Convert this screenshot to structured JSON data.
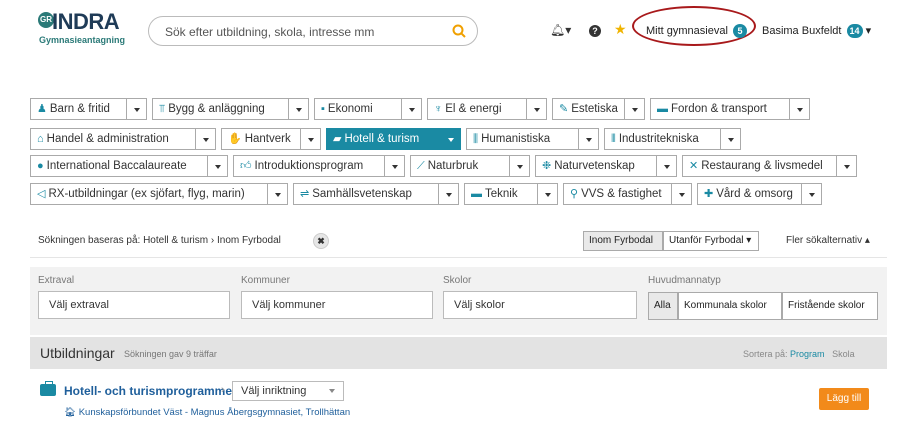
{
  "header": {
    "logo_word": "INDRA",
    "logo_mark": "GR",
    "logo_sub": "Gymnasieantagning",
    "search_placeholder": "Sök efter utbildning, skola, intresse mm",
    "icons": {
      "search": "search-icon",
      "bell": "bell-icon",
      "help": "help-icon",
      "favorite": "star-icon"
    },
    "help_glyph": "?",
    "mitt_label": "Mitt gymnasieval",
    "mitt_count": "5",
    "user_name": "Basima Buxfeldt",
    "user_count": "14"
  },
  "categories": [
    {
      "label": "Barn & fritid",
      "icon": "child-icon",
      "active": false
    },
    {
      "label": "Bygg & anläggning",
      "icon": "crane-icon",
      "active": false
    },
    {
      "label": "Ekonomi",
      "icon": "money-icon",
      "active": false
    },
    {
      "label": "El & energi",
      "icon": "plug-icon",
      "active": false
    },
    {
      "label": "Estetiska",
      "icon": "palette-icon",
      "active": false
    },
    {
      "label": "Fordon & transport",
      "icon": "truck-icon",
      "active": false
    },
    {
      "label": "Handel & administration",
      "icon": "shop-icon",
      "active": false
    },
    {
      "label": "Hantverk",
      "icon": "hands-icon",
      "active": false
    },
    {
      "label": "Hotell & turism",
      "icon": "suitcase-icon",
      "active": true
    },
    {
      "label": "Humanistiska",
      "icon": "columns-icon",
      "active": false
    },
    {
      "label": "Industritekniska",
      "icon": "factory-icon",
      "active": false
    },
    {
      "label": "International Baccalaureate",
      "icon": "globe-icon",
      "active": false
    },
    {
      "label": "Introduktionsprogram",
      "icon": "thumbs-up-icon",
      "active": false
    },
    {
      "label": "Naturbruk",
      "icon": "leaf-icon",
      "active": false
    },
    {
      "label": "Naturvetenskap",
      "icon": "atom-icon",
      "active": false
    },
    {
      "label": "Restaurang & livsmedel",
      "icon": "cutlery-icon",
      "active": false
    },
    {
      "label": "RX-utbildningar (ex sjöfart, flyg, marin)",
      "icon": "megaphone-icon",
      "active": false
    },
    {
      "label": "Samhällsvetenskap",
      "icon": "handshake-icon",
      "active": false
    },
    {
      "label": "Teknik",
      "icon": "laptop-icon",
      "active": false
    },
    {
      "label": "VVS & fastighet",
      "icon": "pipe-icon",
      "active": false
    },
    {
      "label": "Vård & omsorg",
      "icon": "medical-icon",
      "active": false
    }
  ],
  "filterbar": {
    "basis_text": "Sökningen baseras på: Hotell & turism › Inom Fyrbodal",
    "clear_glyph": "✖",
    "inom": "Inom Fyrbodal",
    "utanfor": "Utanför Fyrbodal ▾",
    "more": "Fler sökalternativ ▴"
  },
  "filters": {
    "extraval_label": "Extraval",
    "extraval_value": "Välj extraval",
    "kommuner_label": "Kommuner",
    "kommuner_value": "Välj kommuner",
    "skolor_label": "Skolor",
    "skolor_value": "Välj skolor",
    "huvud_label": "Huvudmannatyp",
    "huvud_options": [
      "Alla",
      "Kommunala skolor",
      "Fristående skolor"
    ]
  },
  "results": {
    "title": "Utbildningar",
    "subtitle": "Sökningen gav 9 träffar",
    "sort_label": "Sortera på:",
    "sort_program": "Program",
    "sort_school": "Skola"
  },
  "row": {
    "program": "Hotell- och turismprogrammet",
    "chevron": "›",
    "inriktning": "Välj inriktning",
    "school": "Kunskapsförbundet Väst - Magnus Åbergsgymnasiet, Trollhättan",
    "add_label": "Lägg till"
  },
  "colors": {
    "accent": "#1a8aa3",
    "orange": "#f28a1a",
    "annotation": "#a8191b"
  }
}
